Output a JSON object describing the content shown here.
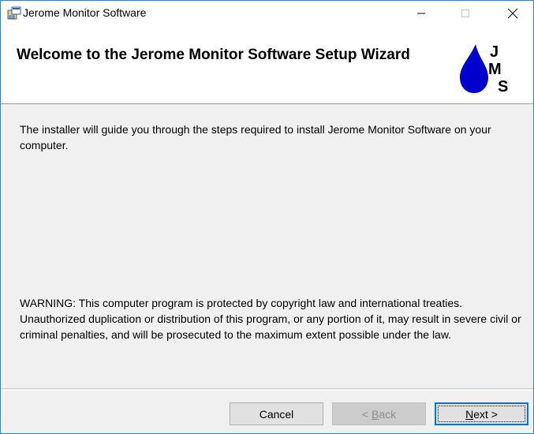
{
  "window": {
    "title": "Jerome Monitor Software",
    "title_icon": "installer-package-icon",
    "controls": [
      "minimize-icon",
      "maximize-icon",
      "close-icon"
    ]
  },
  "banner": {
    "title": "Welcome to the Jerome Monitor Software Setup Wizard",
    "logo_letters": [
      "J",
      "M",
      "S"
    ],
    "logo_color": "#0000cc"
  },
  "content": {
    "intro": "The installer will guide you through the steps required to install Jerome Monitor Software on your computer.",
    "warning": "WARNING: This computer program is protected by copyright law and international treaties. Unauthorized duplication or distribution of this program, or any portion of it, may result in severe civil or criminal penalties, and will be prosecuted to the maximum extent possible under the law."
  },
  "footer": {
    "cancel_label": "Cancel",
    "back_prefix": "< ",
    "back_accel": "B",
    "back_rest": "ack",
    "next_accel": "N",
    "next_rest": "ext >",
    "accent_color": "#0078d7"
  }
}
